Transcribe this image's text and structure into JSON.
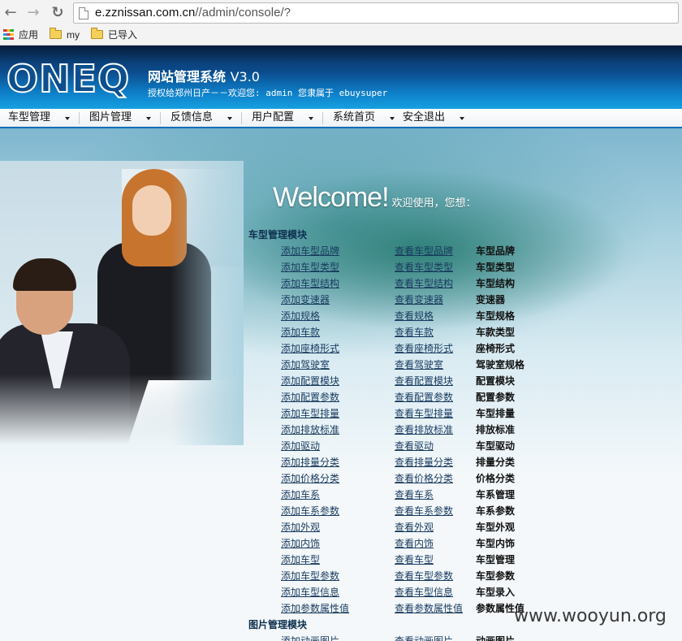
{
  "browser": {
    "url_host": "e.zznissan.com.cn",
    "url_path": "//admin/console/?",
    "bookmarks": [
      "应用",
      "my",
      "已导入"
    ]
  },
  "header": {
    "logo": "ONEQ",
    "system_name": "网站管理系统",
    "version": "V3.0",
    "subtitle": "授权给郑州日产－－欢迎您: admin 您隶属于 ebuysuper"
  },
  "menu": [
    "车型管理",
    "图片管理",
    "反馈信息",
    "用户配置",
    "系统首页",
    "安全退出"
  ],
  "welcome": {
    "big": "Welcome!",
    "small": "欢迎使用，您想："
  },
  "sections": [
    {
      "title": "车型管理模块",
      "rows": [
        {
          "add": "添加车型品牌",
          "view": "查看车型品牌",
          "cat": "车型品牌"
        },
        {
          "add": "添加车型类型",
          "view": "查看车型类型",
          "cat": "车型类型"
        },
        {
          "add": "添加车型结构",
          "view": "查看车型结构",
          "cat": "车型结构"
        },
        {
          "add": "添加变速器",
          "view": "查看变速器",
          "cat": "变速器"
        },
        {
          "add": "添加规格",
          "view": "查看规格",
          "cat": "车型规格"
        },
        {
          "add": "添加车款",
          "view": "查看车款",
          "cat": "车款类型"
        },
        {
          "add": "添加座椅形式",
          "view": "查看座椅形式",
          "cat": "座椅形式"
        },
        {
          "add": "添加驾驶室",
          "view": "查看驾驶室",
          "cat": "驾驶室规格"
        },
        {
          "add": "添加配置模块",
          "view": "查看配置模块",
          "cat": "配置模块"
        },
        {
          "add": "添加配置参数",
          "view": "查看配置参数",
          "cat": "配置参数"
        },
        {
          "add": "添加车型排量",
          "view": "查看车型排量",
          "cat": "车型排量"
        },
        {
          "add": "添加排放标准",
          "view": "查看排放标准",
          "cat": "排放标准"
        },
        {
          "add": "添加驱动",
          "view": "查看驱动",
          "cat": "车型驱动"
        },
        {
          "add": "添加排量分类",
          "view": "查看排量分类",
          "cat": "排量分类"
        },
        {
          "add": "添加价格分类",
          "view": "查看价格分类",
          "cat": "价格分类"
        },
        {
          "add": "添加车系",
          "view": "查看车系",
          "cat": "车系管理"
        },
        {
          "add": "添加车系参数",
          "view": "查看车系参数",
          "cat": "车系参数"
        },
        {
          "add": "添加外观",
          "view": "查看外观",
          "cat": "车型外观"
        },
        {
          "add": "添加内饰",
          "view": "查看内饰",
          "cat": "车型内饰"
        },
        {
          "add": "添加车型",
          "view": "查看车型",
          "cat": "车型管理"
        },
        {
          "add": "添加车型参数",
          "view": "查看车型参数",
          "cat": "车型参数"
        },
        {
          "add": "添加车型信息",
          "view": "查看车型信息",
          "cat": "车型录入"
        },
        {
          "add": "添加参数属性值",
          "view": "查看参数属性值",
          "cat": "参数属性值"
        }
      ]
    },
    {
      "title": "图片管理模块",
      "rows": [
        {
          "add": "添加动画图片",
          "view": "查看动画图片",
          "cat": "动画图片"
        }
      ]
    }
  ],
  "watermark": "www.wooyun.org",
  "colors": {
    "header_dark": "#0a2e5c",
    "header_light": "#17a0e0",
    "link": "#173a5e",
    "section_title": "#0e2f4e"
  }
}
